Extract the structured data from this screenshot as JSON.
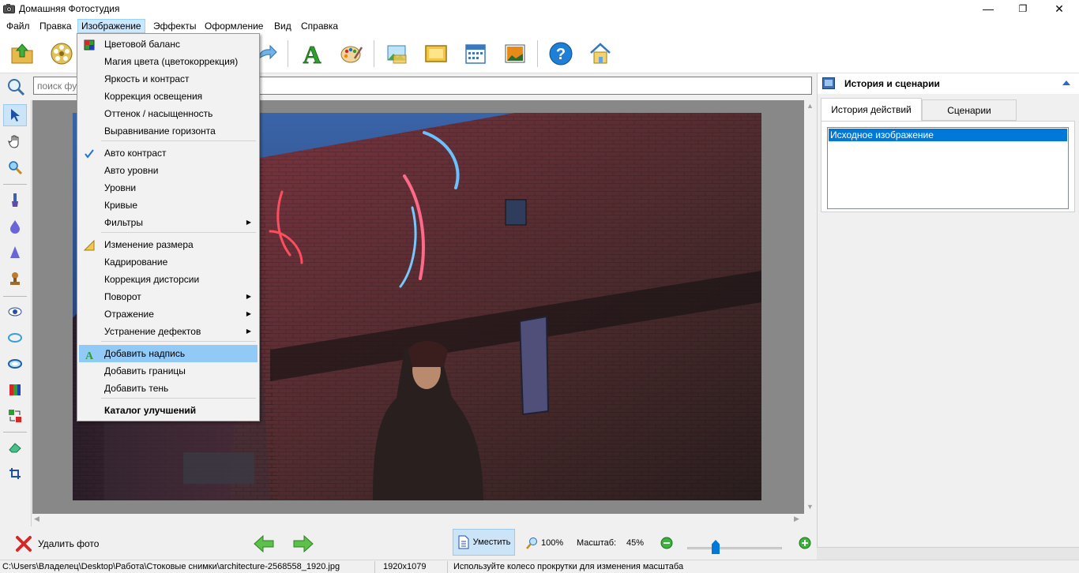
{
  "window": {
    "title": "Домашняя Фотостудия",
    "minimize_glyph": "—",
    "restore_glyph": "❐",
    "close_glyph": "✕"
  },
  "menubar": {
    "items": [
      "Файл",
      "Правка",
      "Изображение",
      "Эффекты",
      "Оформление",
      "Вид",
      "Справка"
    ],
    "active": "Изображение"
  },
  "toolbar": {
    "icons": [
      "open-folder-icon",
      "film-reel-icon",
      "undo-icon",
      "redo-icon",
      "text-tool-icon",
      "palette-icon",
      "landscape-icon",
      "frame-icon",
      "calendar-icon",
      "photo-card-icon",
      "help-icon",
      "home-icon"
    ]
  },
  "search": {
    "placeholder": "поиск функций"
  },
  "image_menu": {
    "items": [
      {
        "label": "Цветовой баланс",
        "icon": "color-balance-icon"
      },
      {
        "label": "Магия цвета (цветокоррекция)"
      },
      {
        "label": "Яркость и контраст"
      },
      {
        "label": "Коррекция освещения"
      },
      {
        "label": "Оттенок / насыщенность"
      },
      {
        "label": "Выравнивание горизонта"
      },
      {
        "label": "Авто контраст",
        "icon": "check-icon"
      },
      {
        "label": "Авто уровни"
      },
      {
        "label": "Уровни"
      },
      {
        "label": "Кривые"
      },
      {
        "label": "Фильтры",
        "submenu": true
      },
      {
        "label": "Изменение размера",
        "icon": "resize-ruler-icon"
      },
      {
        "label": "Кадрирование"
      },
      {
        "label": "Коррекция дисторсии"
      },
      {
        "label": "Поворот",
        "submenu": true
      },
      {
        "label": "Отражение",
        "submenu": true
      },
      {
        "label": "Устранение дефектов",
        "submenu": true
      },
      {
        "label": "Добавить надпись",
        "icon": "text-a-icon",
        "highlighted": true
      },
      {
        "label": "Добавить границы"
      },
      {
        "label": "Добавить тень"
      },
      {
        "label": "Каталог улучшений",
        "bold": true
      }
    ]
  },
  "right_panel": {
    "title": "История и сценарии",
    "tabs": [
      "История действий",
      "Сценарии"
    ],
    "active_tab": "История действий",
    "history_items": [
      "Исходное изображение"
    ]
  },
  "bottom": {
    "delete_label": "Удалить фото",
    "fit_label": "Уместить",
    "actual_size_label": "100%",
    "zoom_label": "Масштаб:",
    "zoom_value": "45%",
    "zoom_fraction": 0.3
  },
  "status": {
    "path": "C:\\Users\\Владелец\\Desktop\\Работа\\Стоковые снимки\\architecture-2568558_1920.jpg",
    "dimensions": "1920x1079",
    "hint": "Используйте колесо прокрутки для изменения масштаба"
  },
  "colors": {
    "accent": "#0078d7",
    "menu_highlight": "#91c9f7",
    "selected_tool": "#cce4f7"
  }
}
